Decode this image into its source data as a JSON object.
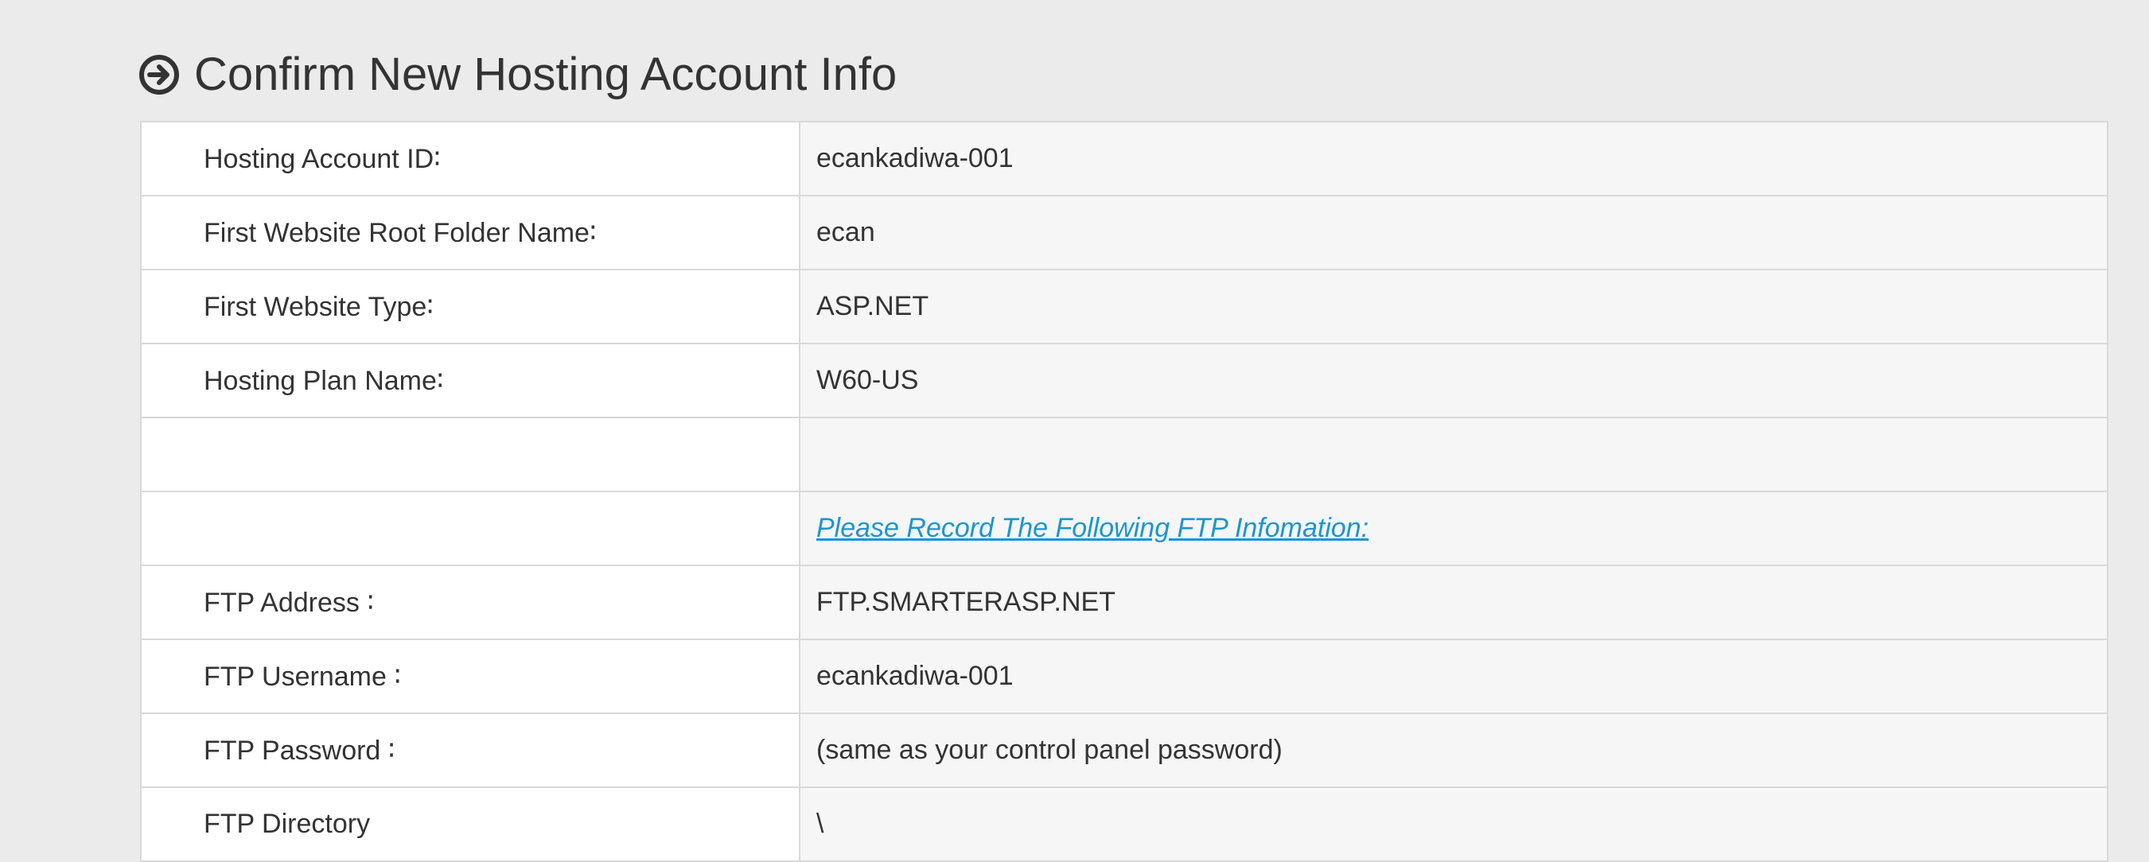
{
  "header": {
    "icon": "circle-arrow-right-icon",
    "title": "Confirm New Hosting Account Info"
  },
  "colors": {
    "page_background": "#ebebeb",
    "text": "#333333",
    "link": "#1e95cf",
    "value_cell_background": "#f6f6f6",
    "label_cell_background": "#ffffff",
    "border": "#d9d9d9"
  },
  "account": {
    "rows": [
      {
        "label": "Hosting Account ID∶",
        "value": "ecankadiwa-001"
      },
      {
        "label": "First Website Root Folder Name∶",
        "value": "ecan"
      },
      {
        "label": "First Website Type∶",
        "value": "ASP.NET"
      },
      {
        "label": "Hosting Plan Name∶",
        "value": "W60-US"
      }
    ]
  },
  "spacer_row": {
    "label": "",
    "value": ""
  },
  "ftp": {
    "notice_link": "Please Record The Following FTP Infomation:",
    "rows": [
      {
        "label": "FTP Address ∶",
        "value": "FTP.SMARTERASP.NET"
      },
      {
        "label": "FTP Username ∶",
        "value": "ecankadiwa-001"
      },
      {
        "label": "FTP Password ∶",
        "value": "(same as your control panel password)"
      },
      {
        "label": "FTP Directory",
        "value": "\\"
      }
    ]
  }
}
